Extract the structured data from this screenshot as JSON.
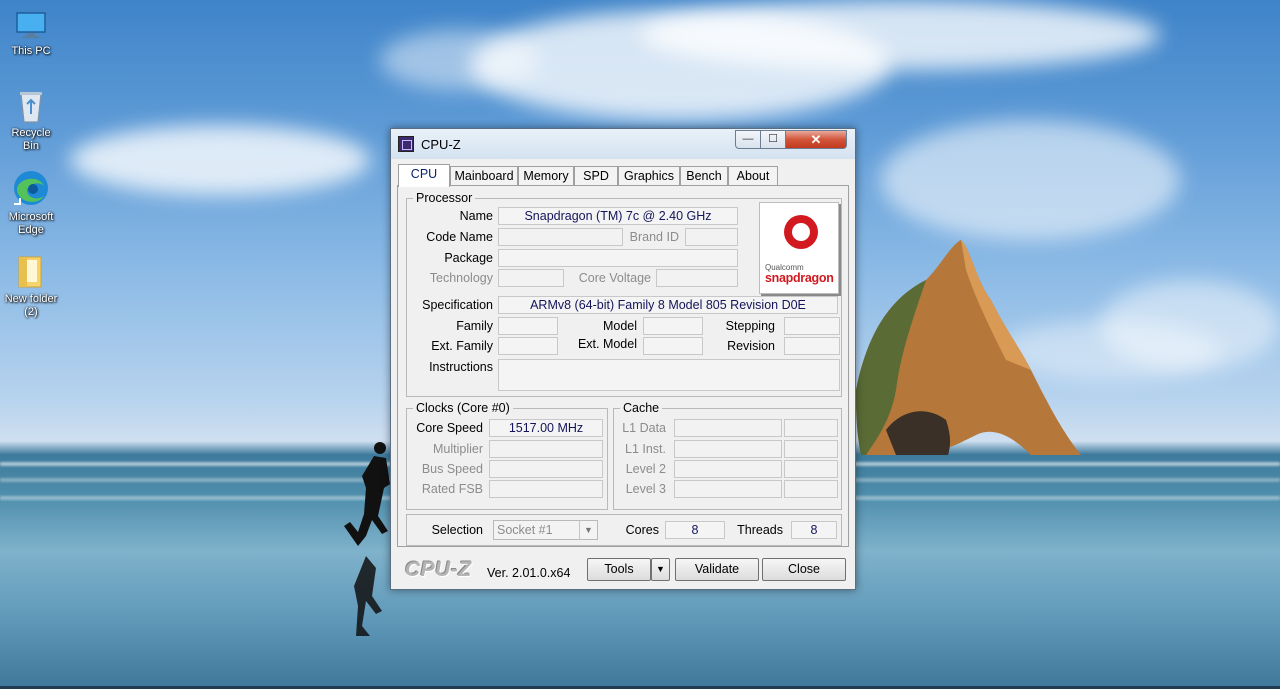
{
  "desktop": {
    "icons": [
      {
        "label": "This PC",
        "icon": "monitor-icon"
      },
      {
        "label": "Recycle Bin",
        "icon": "recycle-bin-icon"
      },
      {
        "label": "Microsoft Edge",
        "icon": "edge-icon"
      },
      {
        "label": "New folder (2)",
        "icon": "folder-icon"
      }
    ]
  },
  "window": {
    "title": "CPU-Z",
    "controls": {
      "minimize": "—",
      "maximize": "☐",
      "close": "✕"
    }
  },
  "tabs": [
    "CPU",
    "Mainboard",
    "Memory",
    "SPD",
    "Graphics",
    "Bench",
    "About"
  ],
  "active_tab": "CPU",
  "processor": {
    "legend": "Processor",
    "name_label": "Name",
    "name": "Snapdragon (TM) 7c @ 2.40 GHz",
    "code_name_label": "Code Name",
    "code_name": "",
    "brand_id_label": "Brand ID",
    "brand_id": "",
    "package_label": "Package",
    "package": "",
    "technology_label": "Technology",
    "technology": "",
    "core_voltage_label": "Core Voltage",
    "core_voltage": "",
    "specification_label": "Specification",
    "specification": "ARMv8 (64-bit) Family 8 Model 805 Revision D0E",
    "family_label": "Family",
    "family": "",
    "model_label": "Model",
    "model": "",
    "stepping_label": "Stepping",
    "stepping": "",
    "ext_family_label": "Ext. Family",
    "ext_family": "",
    "ext_model_label": "Ext. Model",
    "ext_model": "",
    "revision_label": "Revision",
    "revision": "",
    "instructions_label": "Instructions",
    "instructions": "",
    "logo": {
      "small": "Qualcomm",
      "brand": "snapdragon",
      "color": "#d1191f"
    }
  },
  "clocks": {
    "legend": "Clocks (Core #0)",
    "core_speed_label": "Core Speed",
    "core_speed": "1517.00 MHz",
    "multiplier_label": "Multiplier",
    "multiplier": "",
    "bus_speed_label": "Bus Speed",
    "bus_speed": "",
    "rated_fsb_label": "Rated FSB",
    "rated_fsb": ""
  },
  "cache": {
    "legend": "Cache",
    "l1_data_label": "L1 Data",
    "l1_inst_label": "L1 Inst.",
    "level2_label": "Level 2",
    "level3_label": "Level 3"
  },
  "selection": {
    "label": "Selection",
    "value": "Socket #1",
    "cores_label": "Cores",
    "cores": "8",
    "threads_label": "Threads",
    "threads": "8"
  },
  "footer": {
    "brand": "CPU-Z",
    "version": "Ver. 2.01.0.x64",
    "tools_label": "Tools",
    "validate_label": "Validate",
    "close_label": "Close"
  }
}
